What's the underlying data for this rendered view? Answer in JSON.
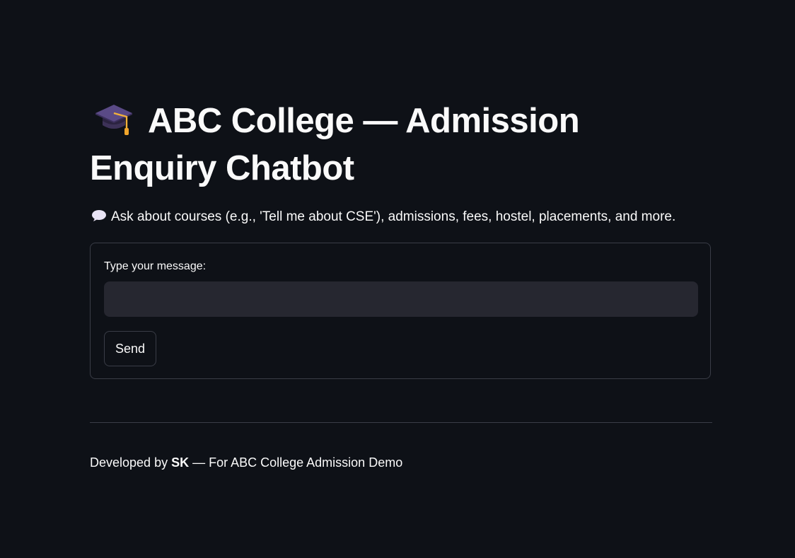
{
  "header": {
    "icon": "graduation-cap-icon",
    "title": "ABC College — Admission Enquiry Chatbot"
  },
  "intro": {
    "icon": "speech-bubble-icon",
    "text": "Ask about courses (e.g., 'Tell me about CSE'), admissions, fees, hostel, placements, and more."
  },
  "form": {
    "label": "Type your message:",
    "value": "",
    "placeholder": "",
    "send_label": "Send"
  },
  "footer": {
    "prefix": "Developed by ",
    "author": "SK",
    "suffix": " — For ABC College Admission Demo"
  },
  "colors": {
    "background": "#0e1117",
    "input_background": "#262730",
    "border": "#3a3d47",
    "text": "#fafafa"
  }
}
